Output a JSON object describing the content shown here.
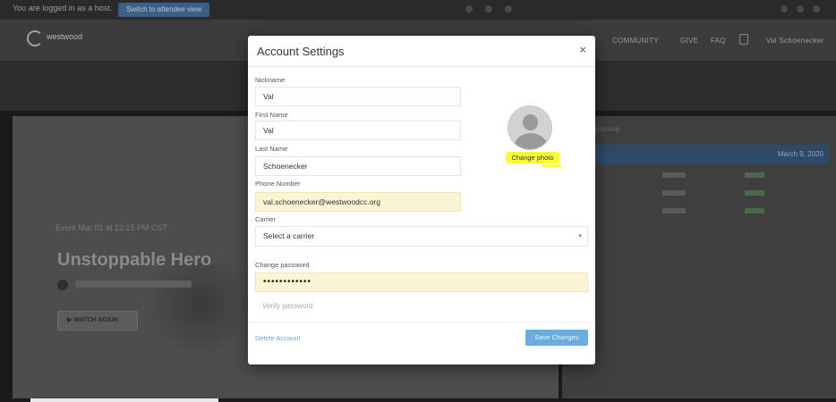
{
  "topbar": {
    "notice": "You are logged in as a host.",
    "cta": "Switch to attendee view"
  },
  "header": {
    "logo_text": "westwood",
    "nav": [
      "COMMUNITY",
      "GIVE",
      "FAQ"
    ],
    "user_name": "Val Schoenecker"
  },
  "background": {
    "event_time": "Event Mar 01 at 12:15 PM CST",
    "event_title": "Unstoppable Hero",
    "watch_label": "WATCH AGAIN",
    "schedule_date": "March 9, 2020",
    "schedule_label": "Upcoming"
  },
  "modal": {
    "title": "Account Settings",
    "close_glyph": "×",
    "fields": {
      "nickname": {
        "label": "Nickname",
        "value": "Val"
      },
      "first_name": {
        "label": "First Name",
        "value": "Val"
      },
      "last_name": {
        "label": "Last Name",
        "value": "Schoenecker"
      },
      "phone": {
        "label": "Phone Number",
        "value": "val.schoenecker@westwoodcc.org"
      },
      "carrier": {
        "label": "Carrier",
        "value": "Select a carrier"
      },
      "change_password": {
        "label": "Change password",
        "value": "••••••••••••"
      },
      "verify_password": {
        "placeholder": "Verify password"
      }
    },
    "change_photo": "Change photo",
    "delete_account": "Delete Account",
    "save_changes": "Save Changes"
  },
  "colors": {
    "highlight": "#fbff3a",
    "autofill": "#fbf4d4",
    "primary_button": "#6aaee0",
    "link": "#6aa7d8"
  }
}
